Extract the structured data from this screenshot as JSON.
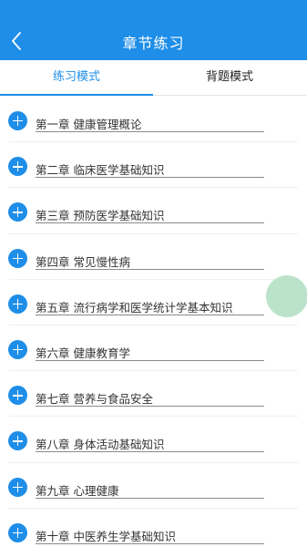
{
  "header": {
    "title": "章节练习"
  },
  "tabs": [
    {
      "label": "练习模式",
      "active": true
    },
    {
      "label": "背题模式",
      "active": false
    }
  ],
  "chapters": [
    "第一章 健康管理概论",
    "第二章 临床医学基础知识",
    "第三章 预防医学基础知识",
    "第四章 常见慢性病",
    "第五章 流行病学和医学统计学基本知识",
    "第六章 健康教育学",
    "第七章 营养与食品安全",
    "第八章 身体活动基础知识",
    "第九章 心理健康",
    "第十章 中医养生学基础知识"
  ],
  "colors": {
    "accent": "#1e8ee8",
    "floating_button": "#b4e0c4"
  },
  "icons": {
    "back": "chevron-left-icon",
    "expand": "plus-circle-icon"
  }
}
